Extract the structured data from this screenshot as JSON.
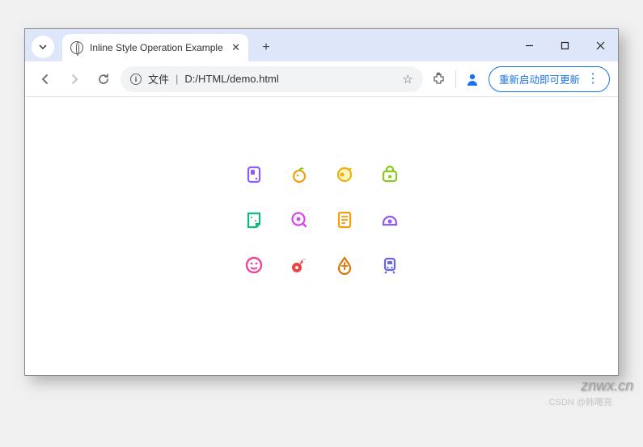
{
  "tab": {
    "title": "Inline Style Operation Example"
  },
  "address": {
    "type_label": "文件",
    "url": "D:/HTML/demo.html"
  },
  "update_button": {
    "label": "重新启动即可更新"
  },
  "icons": [
    {
      "name": "card-icon",
      "color": "#8b5cf6"
    },
    {
      "name": "orange-icon",
      "color": "#f59e0b"
    },
    {
      "name": "dashboard-icon",
      "color": "#eab308"
    },
    {
      "name": "bag-icon",
      "color": "#84cc16"
    },
    {
      "name": "note-icon",
      "color": "#10b981"
    },
    {
      "name": "disc-icon",
      "color": "#d946ef"
    },
    {
      "name": "list-icon",
      "color": "#f59e0b"
    },
    {
      "name": "helmet-icon",
      "color": "#8b5cf6"
    },
    {
      "name": "smiley-icon",
      "color": "#ec4899"
    },
    {
      "name": "ok-icon",
      "color": "#ef4444"
    },
    {
      "name": "drop-icon",
      "color": "#d97706"
    },
    {
      "name": "train-icon",
      "color": "#6366f1"
    }
  ],
  "watermark": "znwx.cn",
  "csdn": "CSDN @韩曙亮"
}
